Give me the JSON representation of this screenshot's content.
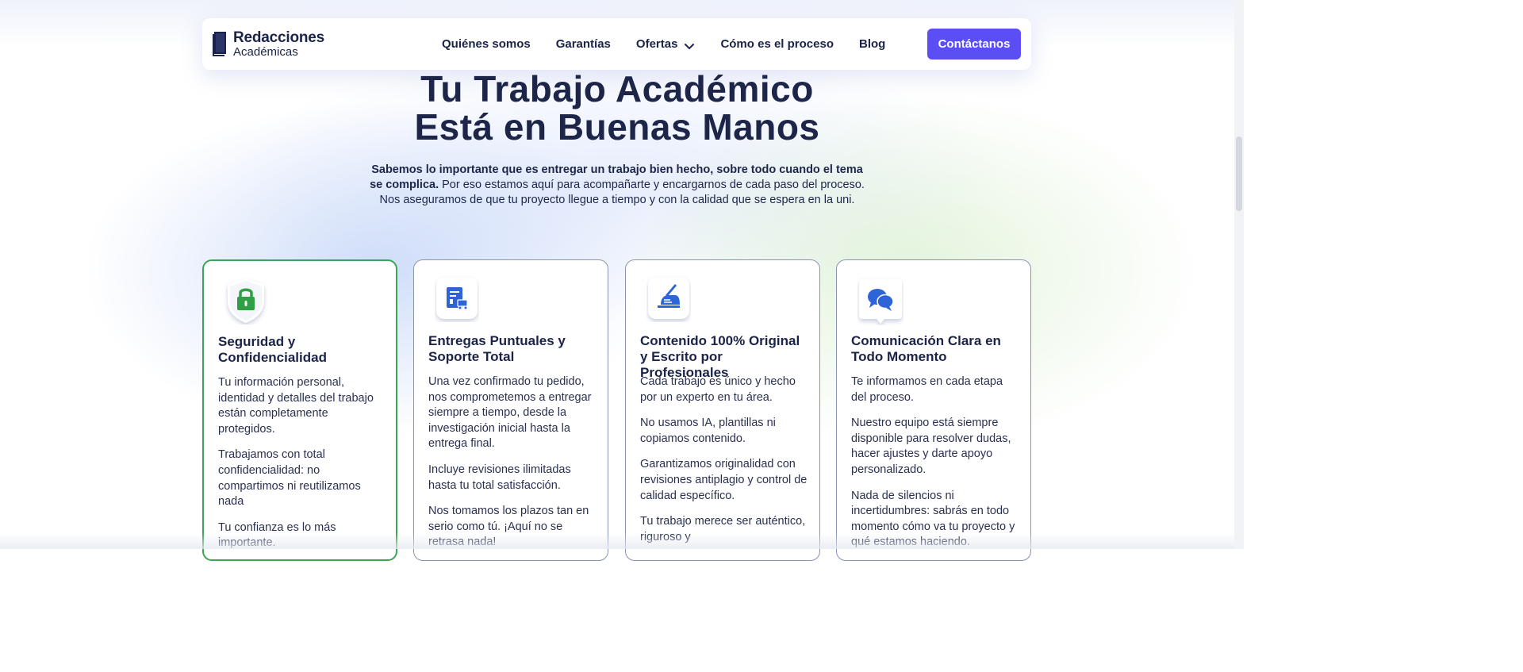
{
  "header": {
    "logo_main": "Redacciones",
    "logo_sub": "Académicas",
    "nav": [
      {
        "label": "Quiénes somos"
      },
      {
        "label": "Garantías"
      },
      {
        "label": "Ofertas",
        "has_dropdown": true
      },
      {
        "label": "Cómo es el proceso"
      },
      {
        "label": "Blog"
      }
    ],
    "cta_label": "Contáctanos"
  },
  "hero": {
    "title_line1": "Tu Trabajo Académico",
    "title_line2": "Está en Buenas Manos",
    "desc_bold": "Sabemos lo importante que es entregar un trabajo bien hecho, sobre todo cuando el tema se complica.",
    "desc_rest": " Por eso estamos aquí para acompañarte y encargarnos de cada paso del proceso. Nos aseguramos de que tu proyecto llegue a tiempo y con la calidad que se espera en la uni."
  },
  "cards": [
    {
      "icon": "lock-shield-icon",
      "title": "Seguridad y Confidencialidad",
      "paragraphs": [
        "Tu información personal, identidad y detalles del trabajo están completamente protegidos.",
        "Trabajamos con total confidencialidad: no compartimos ni reutilizamos nada",
        "Tu confianza es lo más importante."
      ]
    },
    {
      "icon": "delivery-document-icon",
      "title": "Entregas Puntuales y Soporte Total",
      "paragraphs": [
        "Una vez confirmado tu pedido, nos comprometemos a entregar siempre a tiempo, desde la investigación inicial hasta la entrega final.",
        "Incluye revisiones ilimitadas hasta tu total satisfacción.",
        "Nos tomamos los plazos tan en serio como tú. ¡Aquí no se retrasa nada!"
      ]
    },
    {
      "icon": "writing-hand-icon",
      "title": "Contenido 100% Original y Escrito por Profesionales",
      "paragraphs": [
        "Cada trabajo es único y hecho por un experto en tu área.",
        "No usamos IA, plantillas ni copiamos contenido.",
        "Garantizamos originalidad con revisiones antiplagio y control de calidad específico.",
        "Tu trabajo merece ser auténtico, riguroso y"
      ]
    },
    {
      "icon": "chat-bubbles-icon",
      "title": "Comunicación Clara en Todo Momento",
      "paragraphs": [
        "Te informamos en cada etapa del proceso.",
        "Nuestro equipo está siempre disponible para resolver dudas, hacer ajustes y darte apoyo personalizado.",
        "Nada de silencios ni incertidumbres: sabrás en todo momento cómo va tu proyecto y qué estamos haciendo."
      ]
    }
  ],
  "colors": {
    "accent": "#5b4ef5",
    "text_dark": "#1d2649",
    "icon_blue": "#2f63d8",
    "lock_green": "#2fa043",
    "highlight_border": "#3aa655"
  }
}
